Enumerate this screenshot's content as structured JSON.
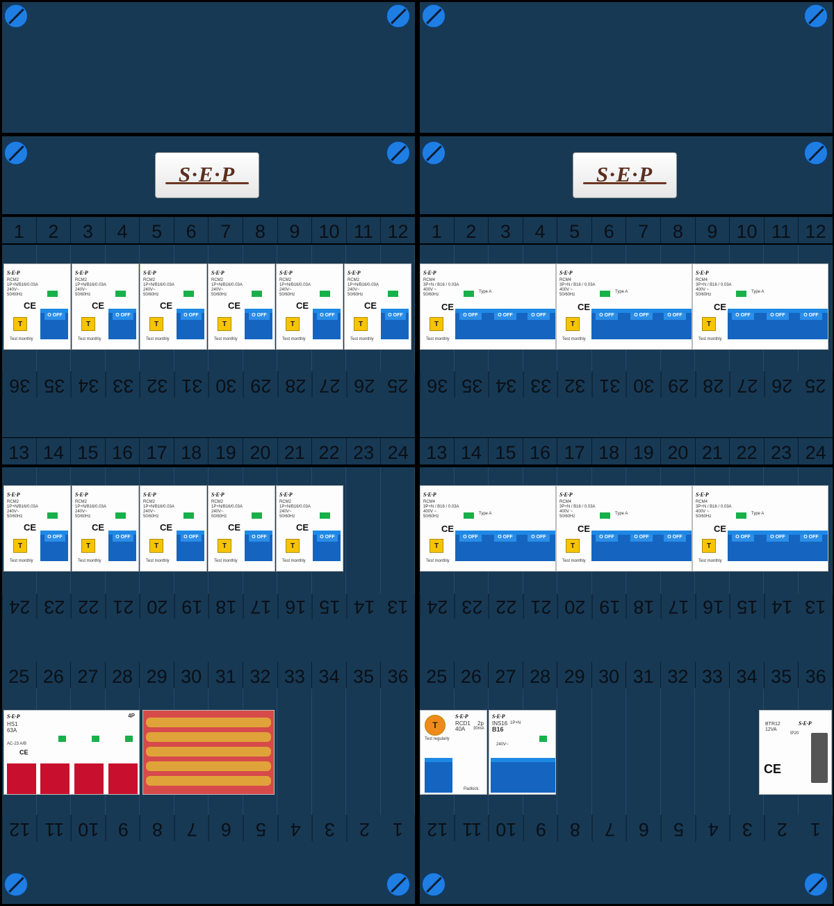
{
  "brand": {
    "logo_text": "S·E·P"
  },
  "row_numbers": {
    "row_a": [
      "1",
      "2",
      "3",
      "4",
      "5",
      "6",
      "7",
      "8",
      "9",
      "10",
      "11",
      "12"
    ],
    "row_a_under": [
      "36",
      "35",
      "34",
      "33",
      "32",
      "31",
      "30",
      "29",
      "28",
      "27",
      "26",
      "25"
    ],
    "row_b": [
      "13",
      "14",
      "15",
      "16",
      "17",
      "18",
      "19",
      "20",
      "21",
      "22",
      "23",
      "24"
    ],
    "row_b_under": [
      "24",
      "23",
      "22",
      "21",
      "20",
      "19",
      "18",
      "17",
      "16",
      "15",
      "14",
      "13"
    ],
    "row_c": [
      "25",
      "26",
      "27",
      "28",
      "29",
      "30",
      "31",
      "32",
      "33",
      "34",
      "35",
      "36"
    ],
    "row_c_under": [
      "12",
      "11",
      "10",
      "9",
      "8",
      "7",
      "6",
      "5",
      "4",
      "3",
      "2",
      "1"
    ]
  },
  "rcm2": {
    "brand": "S·E·P",
    "model": "RCM2",
    "spec": "1P+N/B16/0.03A",
    "voltage": "240V~",
    "freq": "50/60Hz",
    "test": "T",
    "test_label": "Test  monthly",
    "off": "O OFF",
    "ce": "CE"
  },
  "rcm4": {
    "brand": "S·E·P",
    "model": "RCM4",
    "spec": "3P+N / B16 / 0.03A",
    "voltage": "400V ~",
    "freq": "50/60Hz",
    "type": "Type A",
    "test": "T",
    "test_label": "Test  monthly",
    "off": "O OFF",
    "ce": "CE"
  },
  "hs1": {
    "brand": "S·E·P",
    "model": "HS1",
    "rating": "63A",
    "poles": "4P",
    "ac": "AC-23 A/B",
    "ce": "CE"
  },
  "rcd1": {
    "brand": "S·E·P",
    "model": "RCD1",
    "rating": "40A",
    "poles": "2p",
    "ma": "30mA",
    "test": "T",
    "test_label": "Test regularly",
    "padlock": "Padlock"
  },
  "ins16": {
    "brand": "S·E·P",
    "model": "INS16",
    "rating": "B16",
    "poles": "1P+N",
    "voltage": "240V~"
  },
  "btr12": {
    "brand": "S·E·P",
    "model": "BTR12",
    "rating": "12VA",
    "ip": "IP20",
    "ce": "CE"
  },
  "colors": {
    "panel": "#173954",
    "frame": "#000000",
    "screw": "#1f7ee3",
    "lever": "#1565c0",
    "test": "#f7c400",
    "main_switch": "#c8102e"
  }
}
